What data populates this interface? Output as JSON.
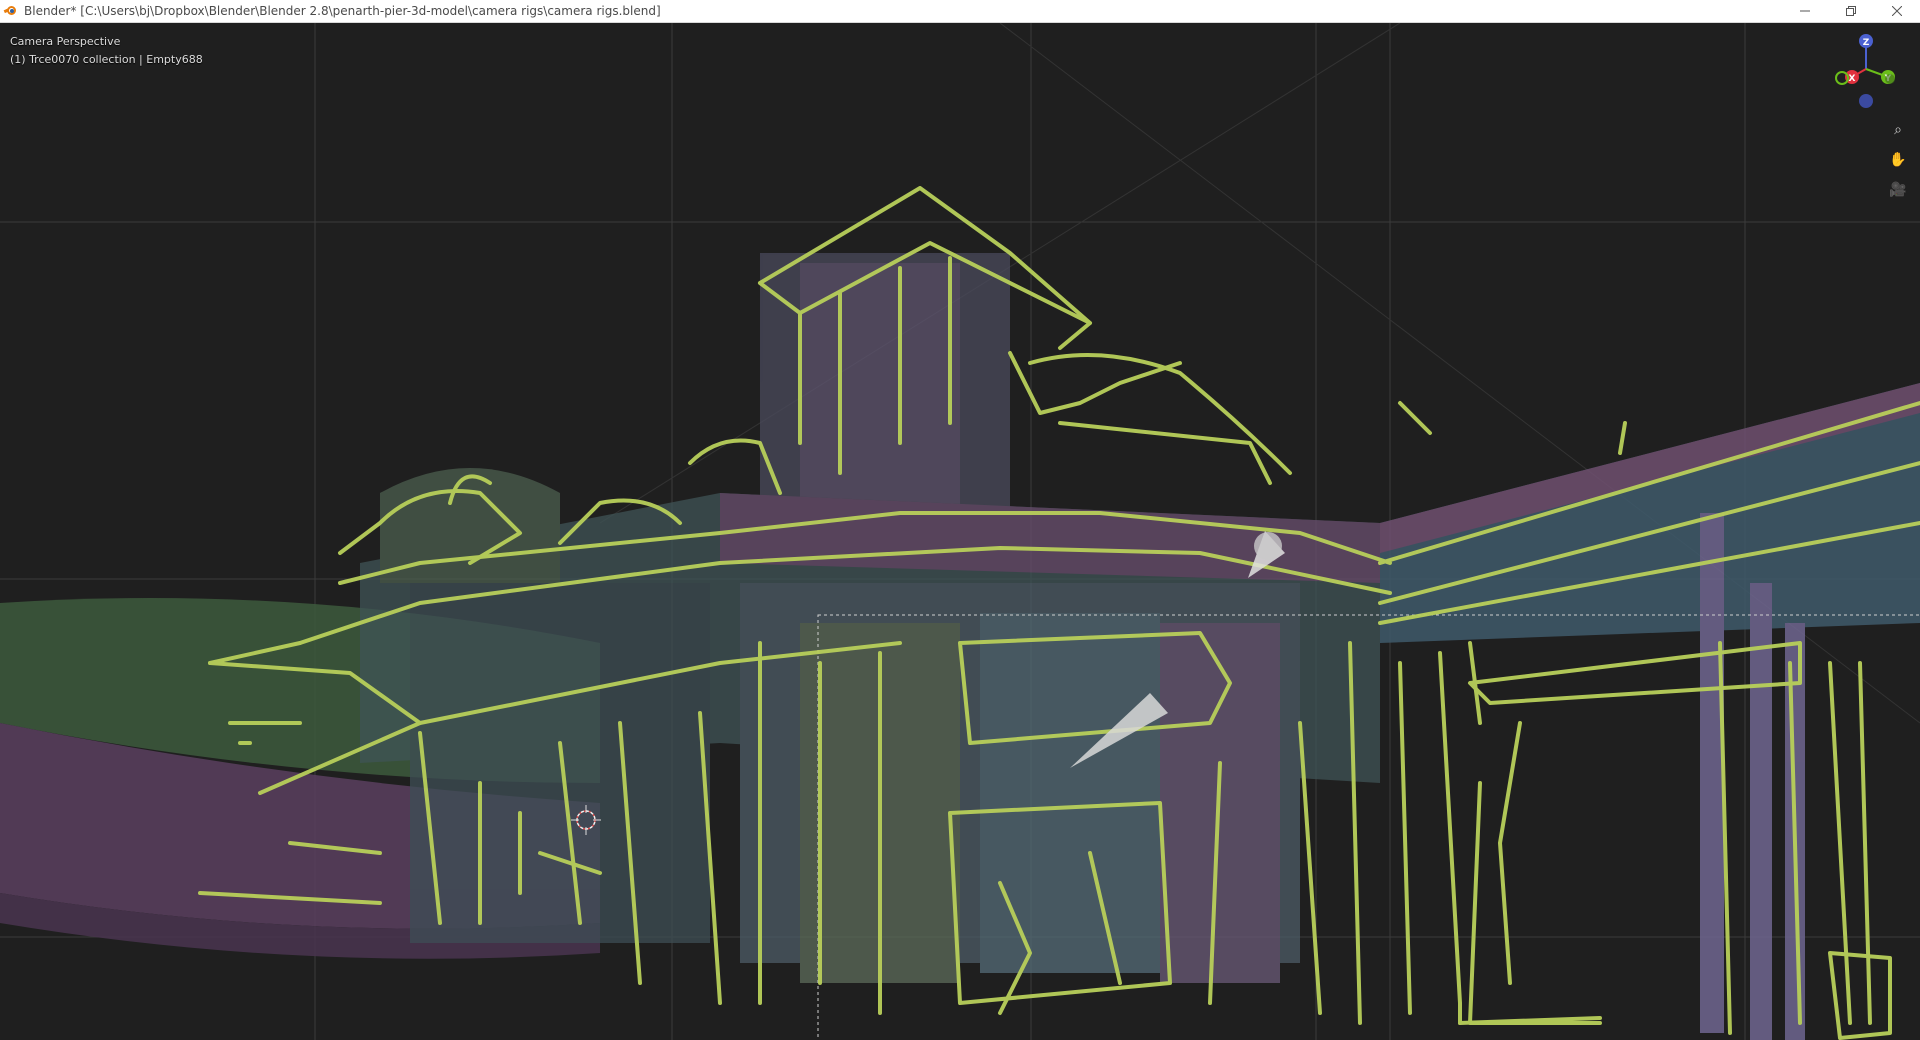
{
  "window": {
    "title": "Blender* [C:\\Users\\bj\\Dropbox\\Blender\\Blender 2.8\\penarth-pier-3d-model\\camera rigs\\camera rigs.blend]",
    "controls": [
      "minimize",
      "restore",
      "close"
    ]
  },
  "viewport": {
    "view_name": "Camera Perspective",
    "collection_info": "(1) Trce0070 collection | Empty688"
  },
  "gizmo": {
    "axes": [
      {
        "label": "Z",
        "color": "#4b61d1"
      },
      {
        "label": "X",
        "color": "#e0313e"
      },
      {
        "label": "Y",
        "color": "#6bbe1a"
      }
    ]
  },
  "nav_tools": [
    {
      "name": "zoom-icon",
      "glyph": "⌕"
    },
    {
      "name": "pan-hand-icon",
      "glyph": "✋"
    },
    {
      "name": "camera-view-icon",
      "glyph": "🎥"
    }
  ],
  "colors": {
    "sketch_stroke": "#b8cf5a",
    "background": "#1f1f1f",
    "grid": "#3a3a3a",
    "structure_purple": "#7a6a9a",
    "structure_teal": "#4f8a8a"
  }
}
